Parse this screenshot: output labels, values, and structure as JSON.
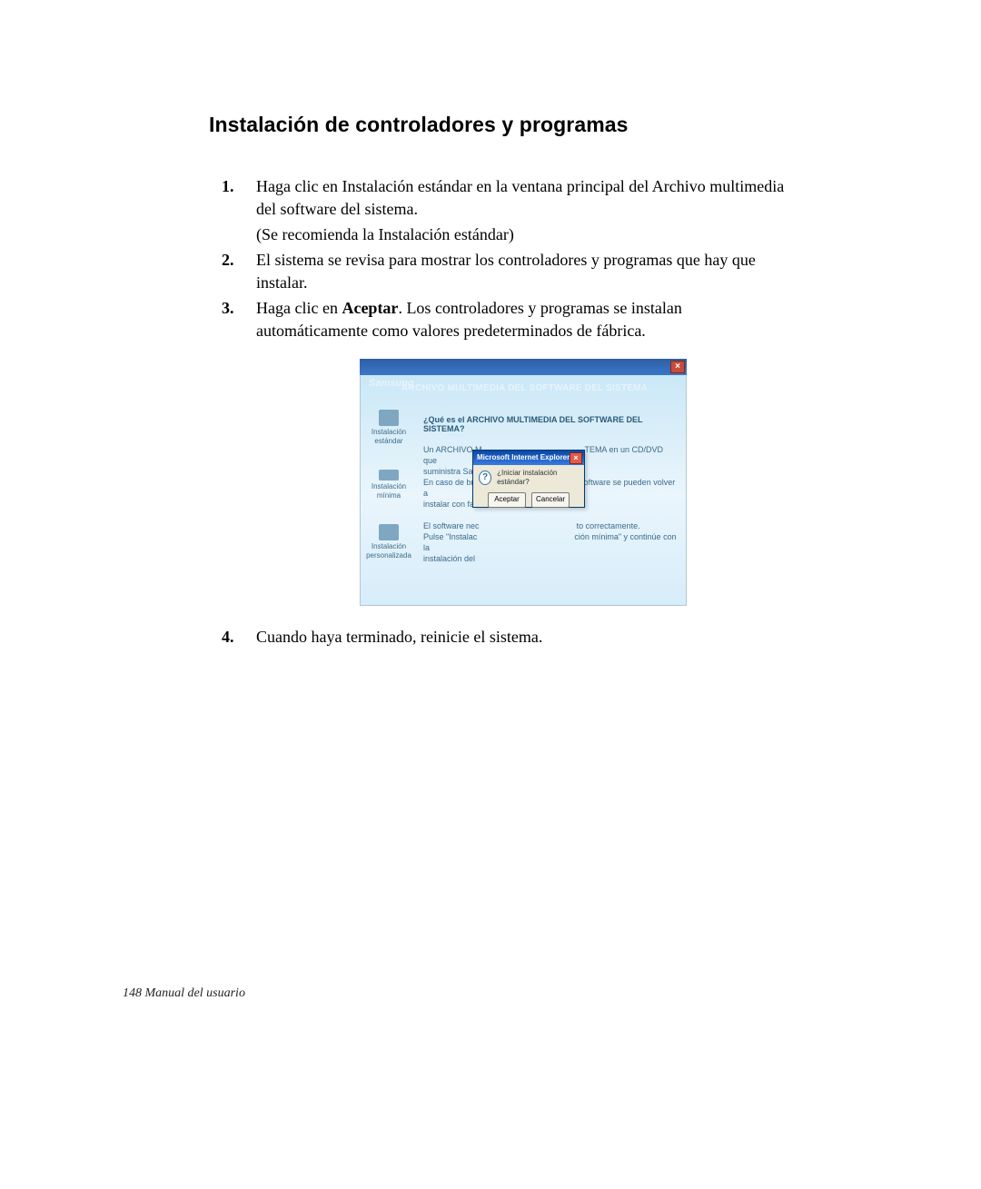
{
  "heading": "Instalación de controladores y programas",
  "steps": {
    "s1a": "Haga clic en Instalación estándar en la ventana principal del Archivo multimedia del software del sistema.",
    "s1b": "(Se recomienda la Instalación estándar)",
    "s2": "El sistema se revisa para mostrar los controladores y programas que hay que instalar.",
    "s3_pre": "Haga clic en ",
    "s3_bold": "Aceptar",
    "s3_post": ". Los controladores y programas se instalan automáticamente como valores predeterminados de fábrica.",
    "s4": "Cuando haya terminado, reinicie el sistema."
  },
  "figure": {
    "brand": "Samsung",
    "title": "ARCHIVO MULTIMEDIA DEL SOFTWARE DEL SISTEMA",
    "question": "¿Qué es el ARCHIVO MULTIMEDIA DEL SOFTWARE DEL SISTEMA?",
    "para1a": "Un ARCHIVO M",
    "para1b": "TEMA en un CD/DVD que",
    "para1c": "suministra Sa",
    "para2a": "En caso de bro",
    "para2b": "l software se pueden volver a",
    "para2c": "instalar con fac",
    "para3a": "El software nec",
    "para3b": "to correctamente.",
    "para3c": "Pulse \"Instalac",
    "para3d": "ción mínima\" y continúe con la",
    "para3e": "instalación del",
    "side_standard": "Instalación estándar",
    "side_minimal": "Instalación mínima",
    "side_custom": "Instalación personalizada",
    "dialog_title": "Microsoft Internet Explorer",
    "dialog_msg": "¿Iniciar instalación estándar?",
    "dialog_accept": "Aceptar",
    "dialog_cancel": "Cancelar",
    "close_glyph": "×",
    "question_glyph": "?"
  },
  "footer": "148  Manual del usuario"
}
